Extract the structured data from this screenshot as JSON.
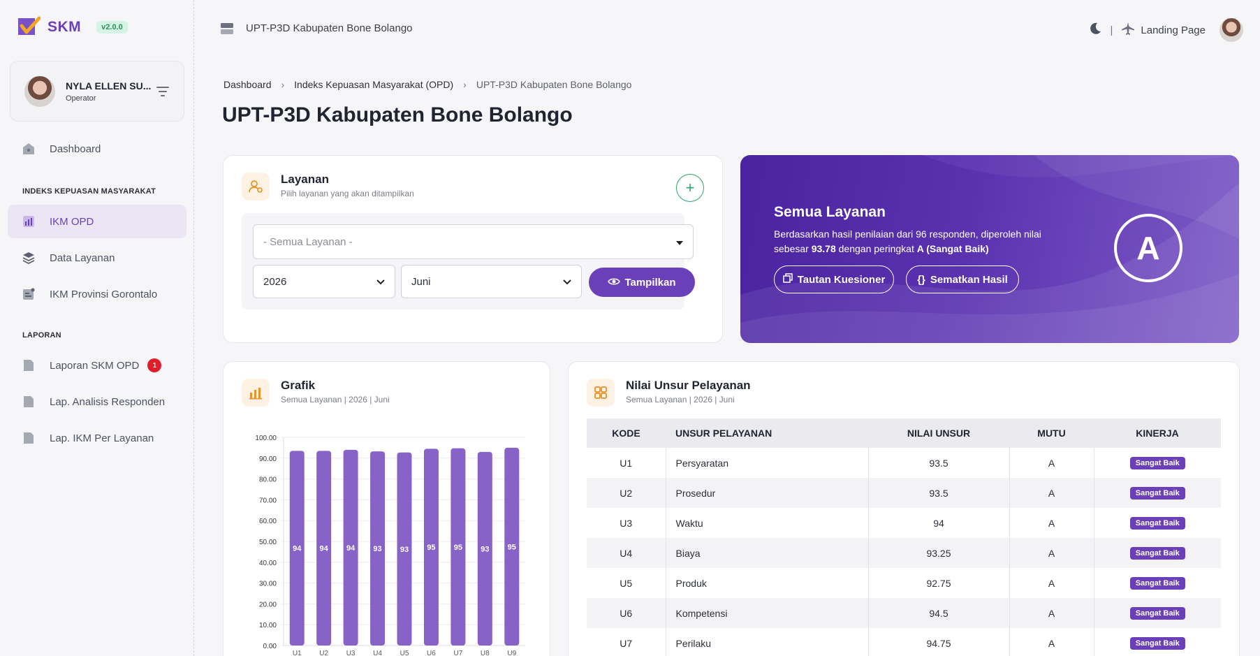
{
  "app": {
    "logo_text": "SKM",
    "version": "v2.0.0"
  },
  "user": {
    "name": "NYLA ELLEN SU...",
    "role": "Operator"
  },
  "sidebar": {
    "items": [
      {
        "label": "Dashboard",
        "icon": "home-icon"
      },
      {
        "label": "IKM OPD",
        "icon": "chart-icon",
        "active": true
      },
      {
        "label": "Data Layanan",
        "icon": "layers-icon"
      },
      {
        "label": "IKM Provinsi Gorontalo",
        "icon": "document-icon"
      },
      {
        "label": "Laporan SKM OPD",
        "icon": "file-icon",
        "badge": "1"
      },
      {
        "label": "Lap. Analisis Responden",
        "icon": "file-icon"
      },
      {
        "label": "Lap. IKM Per Layanan",
        "icon": "file-icon"
      }
    ],
    "section_ikm": "INDEKS KEPUASAN MASYARAKAT",
    "section_laporan": "LAPORAN"
  },
  "topbar": {
    "org": "UPT-P3D Kabupaten Bone Bolango",
    "landing": "Landing Page",
    "separator": "|"
  },
  "breadcrumb": [
    "Dashboard",
    "Indeks Kepuasan Masyarakat (OPD)",
    "UPT-P3D Kabupaten Bone Bolango"
  ],
  "page_title": "UPT-P3D Kabupaten Bone Bolango",
  "layanan_card": {
    "title": "Layanan",
    "subtitle": "Pilih layanan yang akan ditampilkan",
    "service_placeholder": "- Semua Layanan -",
    "year": "2026",
    "month": "Juni",
    "show_button": "Tampilkan"
  },
  "hero": {
    "title": "Semua Layanan",
    "text_1": "Berdasarkan hasil penilaian dari 96 responden, diperoleh nilai sebesar ",
    "score": "93.78",
    "text_2": " dengan peringkat ",
    "rating": "A (Sangat Baik)",
    "grade": "A",
    "btn_kuesioner": "Tautan Kuesioner",
    "btn_sematkan": "Sematkan Hasil"
  },
  "grafik_card": {
    "title": "Grafik",
    "subtitle": "Semua Layanan | 2026 | Juni"
  },
  "chart_data": {
    "type": "bar",
    "categories": [
      "U1",
      "U2",
      "U3",
      "U4",
      "U5",
      "U6",
      "U7",
      "U8",
      "U9"
    ],
    "values": [
      93.5,
      93.5,
      94,
      93.25,
      92.75,
      94.5,
      94.75,
      93,
      95
    ],
    "data_labels": [
      "94",
      "94",
      "94",
      "93",
      "93",
      "95",
      "95",
      "93",
      "95"
    ],
    "y_ticks": [
      "0.00",
      "10.00",
      "20.00",
      "30.00",
      "40.00",
      "50.00",
      "60.00",
      "70.00",
      "80.00",
      "90.00",
      "100.00"
    ],
    "ylim": [
      0,
      100
    ],
    "color": "#7e56c2",
    "grid": true
  },
  "nilai_card": {
    "title": "Nilai Unsur Pelayanan",
    "subtitle": "Semua Layanan | 2026 | Juni",
    "columns": [
      "KODE",
      "UNSUR PELAYANAN",
      "NILAI UNSUR",
      "MUTU",
      "KINERJA"
    ],
    "rows": [
      {
        "kode": "U1",
        "unsur": "Persyaratan",
        "nilai": "93.5",
        "mutu": "A",
        "kinerja": "Sangat Baik"
      },
      {
        "kode": "U2",
        "unsur": "Prosedur",
        "nilai": "93.5",
        "mutu": "A",
        "kinerja": "Sangat Baik"
      },
      {
        "kode": "U3",
        "unsur": "Waktu",
        "nilai": "94",
        "mutu": "A",
        "kinerja": "Sangat Baik"
      },
      {
        "kode": "U4",
        "unsur": "Biaya",
        "nilai": "93.25",
        "mutu": "A",
        "kinerja": "Sangat Baik"
      },
      {
        "kode": "U5",
        "unsur": "Produk",
        "nilai": "92.75",
        "mutu": "A",
        "kinerja": "Sangat Baik"
      },
      {
        "kode": "U6",
        "unsur": "Kompetensi",
        "nilai": "94.5",
        "mutu": "A",
        "kinerja": "Sangat Baik"
      },
      {
        "kode": "U7",
        "unsur": "Perilaku",
        "nilai": "94.75",
        "mutu": "A",
        "kinerja": "Sangat Baik"
      }
    ]
  },
  "colors": {
    "accent": "#6b3fb8",
    "success": "#2ba66a",
    "badge": "#e11d2a"
  }
}
